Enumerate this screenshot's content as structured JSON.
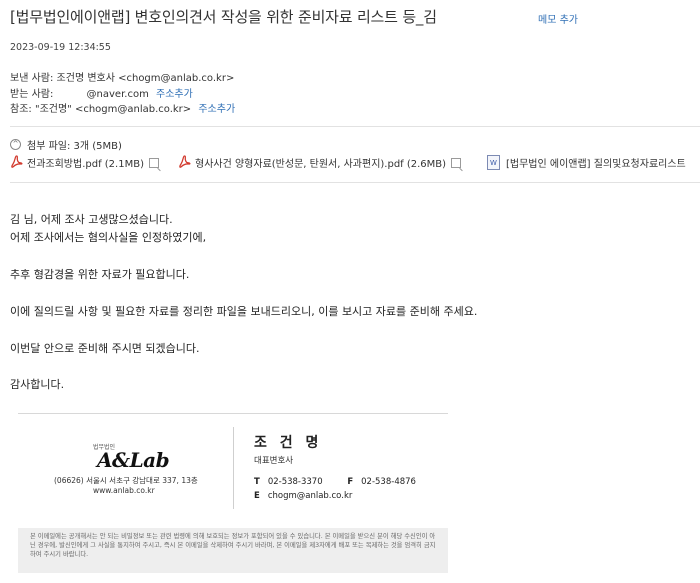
{
  "mail": {
    "subject": "[법무법인에이앤랩] 변호인의견서 작성을 위한 준비자료 리스트 등_김",
    "memo_button": "메모 추가",
    "date": "2023-09-19 12:34:55",
    "from_label": "보낸 사람:",
    "from_value": "조건명 변호사 <chogm@anlab.co.kr>",
    "to_label": "받는 사람:",
    "to_value": "@naver.com",
    "to_add": "주소추가",
    "cc_label": "참조:",
    "cc_value": "\"조건명\" <chogm@anlab.co.kr>",
    "cc_add": "주소추가"
  },
  "attachments": {
    "header": "첨부 파일: 3개 (5MB)",
    "files": [
      {
        "name": "전과조회방법.pdf (2.1MB)",
        "type": "pdf"
      },
      {
        "name": "형사사건 양형자료(반성문, 탄원서, 사과편지).pdf (2.6MB)",
        "type": "pdf"
      },
      {
        "name": "[법무법인 에이앤랩] 질의및요청자료리스트",
        "type": "word"
      }
    ]
  },
  "body": {
    "lines": [
      "김      님, 어제 조사 고생많으셨습니다.",
      "어제 조사에서는 혐의사실을 인정하였기에,",
      "추후 형감경을 위한 자료가 필요합니다.",
      "이에 질의드릴 사항 및 필요한 자료를 정리한 파일을 보내드리오니, 이를 보시고 자료를 준비해 주세요.",
      "이번달 안으로 준비해 주시면 되겠습니다.",
      "감사합니다."
    ]
  },
  "signature": {
    "firm_small": "법무법인",
    "logo": "A&Lab",
    "address": "(06626) 서울시 서초구 강남대로 337, 13층",
    "website": "www.anlab.co.kr",
    "name": "조 건 명",
    "title": "대표변호사",
    "tel_label": "T",
    "tel": "02-538-3370",
    "fax_label": "F",
    "fax": "02-538-4876",
    "email_label": "E",
    "email": "chogm@anlab.co.kr"
  },
  "disclaimer": "본 이메일에는 공개해서는 안 되는 비밀정보 또는 관련 법령에 의해 보호되는 정보가 포함되어 있을 수 있습니다. 본 이메일을 받으신 분이 해당 수신인이 아닌 경우에, 발신인에게 그 사실을 통지하여 주시고, 즉시 본 이메일을 삭제하여 주시기 바라며, 본 이메일을 제3자에게 배포 또는 복제하는 것을 엄격히 금지하여 주시기 바랍니다.",
  "colors": {
    "link": "#2f6fb5",
    "pdf_red": "#d23b2f"
  }
}
